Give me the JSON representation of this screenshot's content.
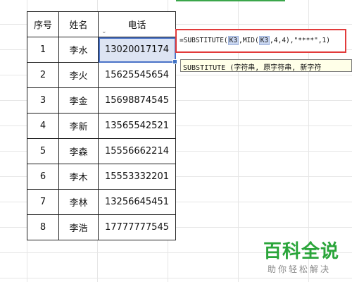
{
  "sheet": {
    "headers": [
      "序号",
      "姓名",
      "电话"
    ],
    "rows": [
      {
        "no": "1",
        "name": "李水",
        "phone": "13020017174"
      },
      {
        "no": "2",
        "name": "李火",
        "phone": "15625545654"
      },
      {
        "no": "3",
        "name": "李金",
        "phone": "15698874545"
      },
      {
        "no": "4",
        "name": "李新",
        "phone": "13565542521"
      },
      {
        "no": "5",
        "name": "李森",
        "phone": "15556662214"
      },
      {
        "no": "6",
        "name": "李木",
        "phone": "15553332201"
      },
      {
        "no": "7",
        "name": "李林",
        "phone": "13256645451"
      },
      {
        "no": "8",
        "name": "李浩",
        "phone": "17777777545"
      }
    ]
  },
  "formula": {
    "p1": "=SUBSTITUTE(",
    "ref1": "K3",
    "p2": ",MID(",
    "ref2": "K3",
    "p3": ",4,4),",
    "p4": "\"****\"",
    "p5": ",1)"
  },
  "tooltip": "SUBSTITUTE (字符串, 原字符串, 新字符",
  "watermark": {
    "title": "百科全说",
    "subtitle": "助你轻松解决"
  },
  "colors": {
    "selection": "#4a73c7",
    "formula_border": "#e23b3b",
    "brand_green": "#2aa53a"
  }
}
